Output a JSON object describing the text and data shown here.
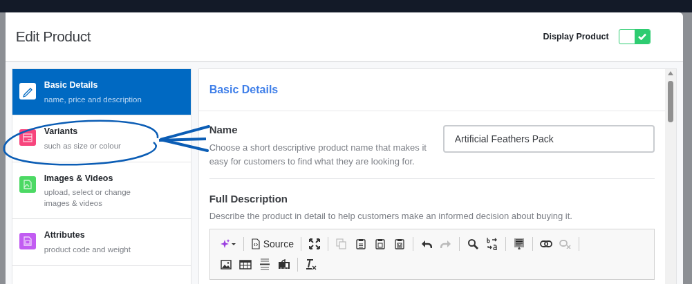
{
  "window": {
    "title": "Edit Product"
  },
  "display_toggle": {
    "label": "Display Product",
    "on": true
  },
  "sidebar": {
    "items": [
      {
        "title": "Basic Details",
        "subtitle": "name, price and description",
        "selected": true,
        "color": "#ffffff",
        "kind": "pencil"
      },
      {
        "title": "Variants",
        "subtitle": "such as size or colour",
        "selected": false,
        "color": "#f7457d",
        "kind": "box"
      },
      {
        "title": "Images & Videos",
        "subtitle": "upload, select or change images & videos",
        "selected": false,
        "color": "#4cd964",
        "kind": "image"
      },
      {
        "title": "Attributes",
        "subtitle": "product code and weight",
        "selected": false,
        "color": "#c25cf2",
        "kind": "document"
      }
    ]
  },
  "section": {
    "title": "Basic Details"
  },
  "name_field": {
    "label": "Name",
    "help": "Choose a short descriptive product name that makes it easy for customers to find what they are looking for.",
    "value": "Artificial Feathers Pack"
  },
  "description": {
    "label": "Full Description",
    "help": "Describe the product in detail to help customers make an informed decision about buying it.",
    "toolbar": [
      [
        {
          "kind": "ai",
          "disabled": false
        },
        {
          "kind": "separator"
        },
        {
          "kind": "source",
          "label": "Source",
          "disabled": false
        },
        {
          "kind": "separator"
        },
        {
          "kind": "maximize",
          "disabled": false
        },
        {
          "kind": "separator"
        },
        {
          "kind": "copy",
          "disabled": true
        },
        {
          "kind": "paste",
          "disabled": false
        },
        {
          "kind": "pastetext",
          "disabled": false
        },
        {
          "kind": "pasteword",
          "disabled": false
        },
        {
          "kind": "separator"
        },
        {
          "kind": "undo",
          "disabled": false
        },
        {
          "kind": "redo",
          "disabled": true
        },
        {
          "kind": "separator"
        },
        {
          "kind": "find",
          "disabled": false
        },
        {
          "kind": "replace",
          "disabled": false
        },
        {
          "kind": "separator"
        },
        {
          "kind": "selectall",
          "disabled": false
        },
        {
          "kind": "separator"
        },
        {
          "kind": "link",
          "disabled": false
        },
        {
          "kind": "unlink",
          "disabled": true
        },
        {
          "kind": "separator"
        }
      ],
      [
        {
          "kind": "image",
          "disabled": false
        },
        {
          "kind": "table",
          "disabled": false
        },
        {
          "kind": "hline",
          "disabled": false
        },
        {
          "kind": "media",
          "disabled": false
        },
        {
          "kind": "separator"
        },
        {
          "kind": "removeformat",
          "disabled": false
        }
      ]
    ]
  }
}
